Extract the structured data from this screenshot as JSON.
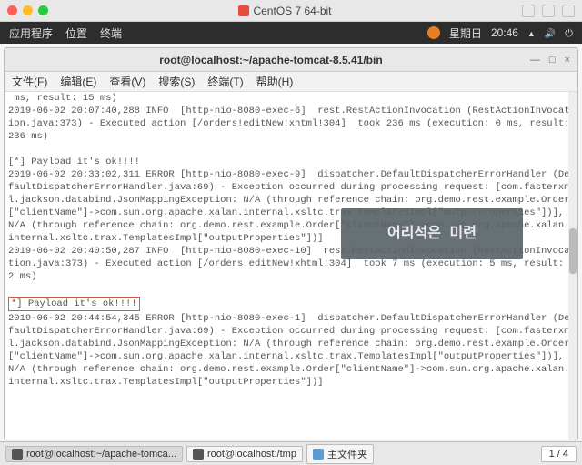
{
  "vm": {
    "title": "CentOS 7 64-bit"
  },
  "panel": {
    "apps": "应用程序",
    "places": "位置",
    "terminal": "终端",
    "day": "星期日",
    "time": "20:46"
  },
  "terminal": {
    "title": "root@localhost:~/apache-tomcat-8.5.41/bin",
    "menu": {
      "file": "文件(F)",
      "edit": "编辑(E)",
      "view": "查看(V)",
      "search": "搜索(S)",
      "term": "终端(T)",
      "help": "帮助(H)"
    },
    "lines": {
      "l0": " ms, result: 15 ms)",
      "l1": "2019-06-02 20:07:40,288 INFO  [http-nio-8080-exec-6]  rest.RestActionInvocation (RestActionInvocation.java:373) - Executed action [/orders!editNew!xhtml!304]  took 236 ms (execution: 0 ms, result: 236 ms)",
      "l2": " ",
      "l3": "[*] Payload it's ok!!!!",
      "l4": "2019-06-02 20:33:02,311 ERROR [http-nio-8080-exec-9]  dispatcher.DefaultDispatcherErrorHandler (DefaultDispatcherErrorHandler.java:69) - Exception occurred during processing request: [com.fasterxml.jackson.databind.JsonMappingException: N/A (through reference chain: org.demo.rest.example.Order[\"clientName\"]->com.sun.org.apache.xalan.internal.xsltc.trax.TemplatesImpl[\"outputProperties\"])], N/A (through reference chain: org.demo.rest.example.Order[\"clientName\"]->com.sun.org.apache.xalan.internal.xsltc.trax.TemplatesImpl[\"outputProperties\"])]",
      "l5": "2019-06-02 20:40:50,287 INFO  [http-nio-8080-exec-10]  rest.RestActionInvocation (RestActionInvocation.java:373) - Executed action [/orders!editNew!xhtml!304]  took 7 ms (execution: 5 ms, result: 2 ms)",
      "l6": " ",
      "l7": "*] Payload it's ok!!!!",
      "l8": "2019-06-02 20:44:54,345 ERROR [http-nio-8080-exec-1]  dispatcher.DefaultDispatcherErrorHandler (DefaultDispatcherErrorHandler.java:69) - Exception occurred during processing request: [com.fasterxml.jackson.databind.JsonMappingException: N/A (through reference chain: org.demo.rest.example.Order[\"clientName\"]->com.sun.org.apache.xalan.internal.xsltc.trax.TemplatesImpl[\"outputProperties\"])], N/A (through reference chain: org.demo.rest.example.Order[\"clientName\"]->com.sun.org.apache.xalan.internal.xsltc.trax.TemplatesImpl[\"outputProperties\"])]"
    }
  },
  "overlay": {
    "text": "어리석은 미련"
  },
  "taskbar": {
    "task1": "root@localhost:~/apache-tomca...",
    "task2": "root@localhost:/tmp",
    "task3": "主文件夹",
    "pages": "1 / 4"
  }
}
